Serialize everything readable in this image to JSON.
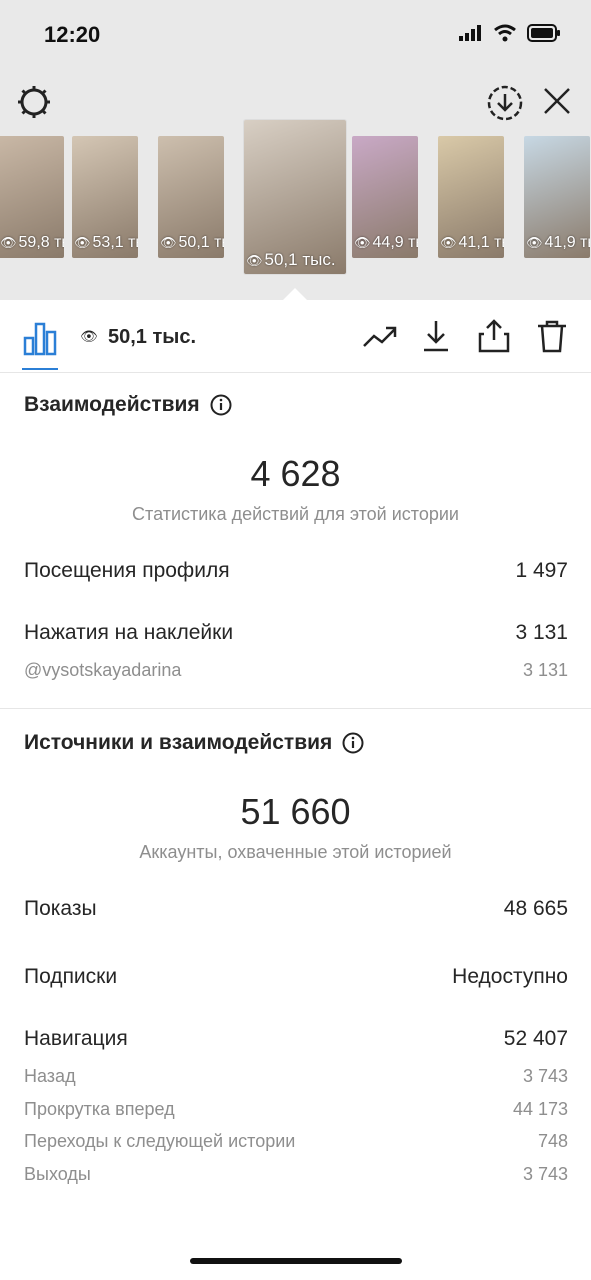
{
  "status_bar": {
    "time": "12:20"
  },
  "thumbnails": [
    {
      "views": "59,8 тыс.",
      "bg": "#c9b8a6"
    },
    {
      "views": "53,1 тыс.",
      "bg": "#d4c6b4"
    },
    {
      "views": "50,1 тыс.",
      "bg": "#cdbfae"
    },
    {
      "views": "50,1 тыс.",
      "bg": "#d8cfc4",
      "selected": true
    },
    {
      "views": "44,9 тыс.",
      "bg": "#c9a9c6"
    },
    {
      "views": "41,1 тыс.",
      "bg": "#d9c9a8"
    },
    {
      "views": "41,9 тыс.",
      "bg": "#c7d8e4"
    }
  ],
  "toolbar": {
    "view_count": "50,1 тыс."
  },
  "interactions": {
    "title": "Взаимодействия",
    "total": "4 628",
    "caption": "Статистика действий для этой истории",
    "rows": [
      {
        "label": "Посещения профиля",
        "value": "1 497"
      },
      {
        "label": "Нажатия на наклейки",
        "value": "3 131"
      }
    ],
    "sub_rows": [
      {
        "label": "@vysotskayadarina",
        "value": "3 131"
      }
    ]
  },
  "discovery": {
    "title": "Источники и взаимодействия",
    "total": "51 660",
    "caption": "Аккаунты, охваченные этой историей",
    "rows": [
      {
        "label": "Показы",
        "value": "48 665"
      },
      {
        "label": "Подписки",
        "value": "Недоступно"
      },
      {
        "label": "Навигация",
        "value": "52 407"
      }
    ],
    "navigation_details": [
      {
        "label": "Назад",
        "value": "3 743"
      },
      {
        "label": "Прокрутка вперед",
        "value": "44 173"
      },
      {
        "label": "Переходы к следующей истории",
        "value": "748"
      },
      {
        "label": "Выходы",
        "value": "3 743"
      }
    ]
  },
  "colors": {
    "accent": "#2b7fd6",
    "text": "#262626",
    "secondary": "#8e8e8e"
  }
}
